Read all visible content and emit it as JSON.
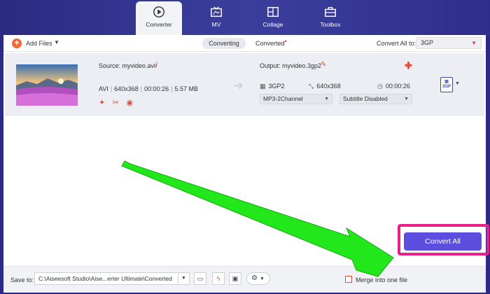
{
  "tabs": [
    {
      "label": "Converter",
      "icon": "converter-icon",
      "active": true
    },
    {
      "label": "MV",
      "icon": "mv-icon",
      "active": false
    },
    {
      "label": "Collage",
      "icon": "collage-icon",
      "active": false
    },
    {
      "label": "Toolbox",
      "icon": "toolbox-icon",
      "active": false
    }
  ],
  "toolbar": {
    "add_files": "Add Files",
    "converting": "Converting",
    "converted": "Converted",
    "converted_dot": "•",
    "convert_all_to": "Convert All to:",
    "format": "3GP"
  },
  "file": {
    "source": "Source: myvideo.avi",
    "container": "AVI",
    "resolution": "640x368",
    "duration": "00:00:26",
    "size": "5.57 MB",
    "output": "Output: myvideo.3gp2",
    "out_format": "3GP2",
    "out_resolution": "640x368",
    "out_duration": "00:00:26",
    "audio": "MP3-2Channel",
    "subtitle": "Subtitle Disabled",
    "badge_format": "3GP"
  },
  "bottom": {
    "save_to": "Save to:",
    "path": "C:\\Aiseesoft Studio\\Aise...erter Ultimate\\Converted",
    "merge": "Merge into one file",
    "convert_all": "Convert All"
  },
  "colors": {
    "accent": "#5c4fe0",
    "highlight": "#e8208a",
    "arrow": "#22e81b",
    "brand_bar": "#2b2a86",
    "icon_red": "#e24b3b"
  }
}
